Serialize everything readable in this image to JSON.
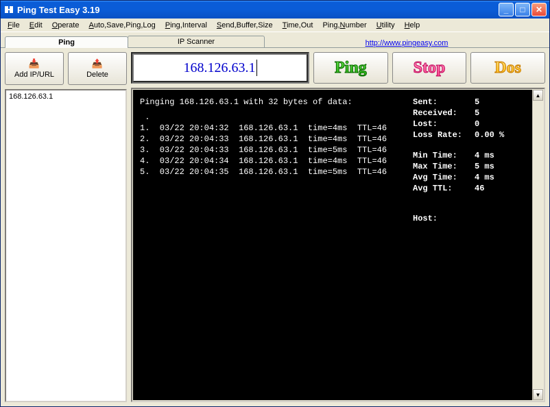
{
  "title": "Ping Test Easy 3.19",
  "menu": {
    "file": "File",
    "edit": "Edit",
    "operate": "Operate",
    "autosave": "Auto,Save,Ping,Log",
    "interval": "Ping,Interval",
    "buffer": "Send,Buffer,Size",
    "timeout": "Time,Out",
    "number": "Ping,Number",
    "utility": "Utility",
    "help": "Help"
  },
  "tabs": {
    "ping": "Ping",
    "ips": "IP Scanner",
    "link": "http://www.pingeasy.com"
  },
  "left": {
    "add": "Add IP/URL",
    "delete": "Delete",
    "list": [
      "168.126.63.1"
    ]
  },
  "ip_input": "168.126.63.1",
  "buttons": {
    "ping": "Ping",
    "stop": "Stop",
    "dos": "Dos"
  },
  "term": {
    "header": "Pinging  168.126.63.1  with 32 bytes of data:",
    "rows": [
      {
        "n": "1.",
        "dt": "03/22 20:04:32",
        "ip": "168.126.63.1",
        "time": "time=4ms",
        "ttl": "TTL=46"
      },
      {
        "n": "2.",
        "dt": "03/22 20:04:33",
        "ip": "168.126.63.1",
        "time": "time=4ms",
        "ttl": "TTL=46"
      },
      {
        "n": "3.",
        "dt": "03/22 20:04:33",
        "ip": "168.126.63.1",
        "time": "time=5ms",
        "ttl": "TTL=46"
      },
      {
        "n": "4.",
        "dt": "03/22 20:04:34",
        "ip": "168.126.63.1",
        "time": "time=4ms",
        "ttl": "TTL=46"
      },
      {
        "n": "5.",
        "dt": "03/22 20:04:35",
        "ip": "168.126.63.1",
        "time": "time=5ms",
        "ttl": "TTL=46"
      }
    ],
    "stats": {
      "sent_k": "Sent:",
      "sent_v": "5",
      "recv_k": "Received:",
      "recv_v": "5",
      "lost_k": "Lost:",
      "lost_v": "0",
      "rate_k": "Loss Rate:",
      "rate_v": "0.00 %",
      "min_k": "Min Time:",
      "min_v": "4 ms",
      "max_k": "Max Time:",
      "max_v": "5 ms",
      "avg_k": "Avg Time:",
      "avg_v": "4 ms",
      "ttl_k": "Avg TTL:",
      "ttl_v": "46",
      "host_k": "Host:",
      "host_v": ""
    }
  }
}
